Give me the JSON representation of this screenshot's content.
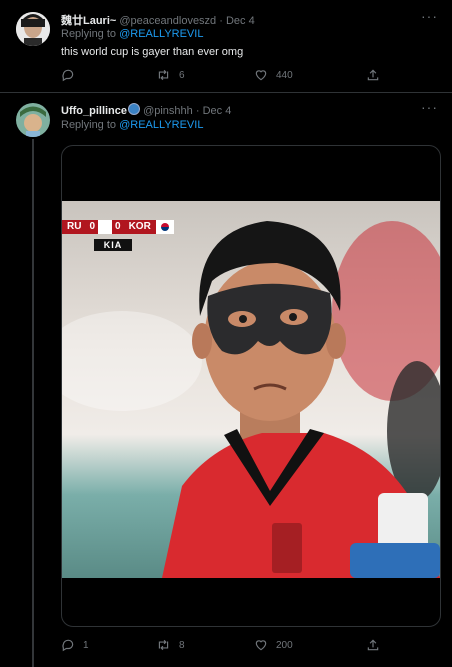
{
  "tweets": [
    {
      "display_name": "魏廿Lauri~",
      "handle": "@peaceandloveszd",
      "date": "Dec 4",
      "replying_prefix": "Replying to",
      "replying_to": "@REALLYREVIL",
      "text": "this world cup is gayer than ever omg",
      "replies": "",
      "retweets": "6",
      "likes": "440"
    },
    {
      "display_name": "Uffo_pillince",
      "handle": "@pinshhh",
      "date": "Dec 4",
      "replying_prefix": "Replying to",
      "replying_to": "@REALLYREVIL",
      "replies": "1",
      "retweets": "8",
      "likes": "200",
      "media": {
        "scoreboard": {
          "team1": "RU",
          "score1": "0",
          "score2": "0",
          "team2": "KOR"
        },
        "sponsor": "KIA"
      }
    }
  ],
  "icons": [
    "reply-icon",
    "retweet-icon",
    "like-icon",
    "share-icon",
    "more-icon"
  ],
  "colors": {
    "background": "#000000",
    "link": "#1d9bf0",
    "muted": "#71767b",
    "jersey": "#d92a2f"
  }
}
